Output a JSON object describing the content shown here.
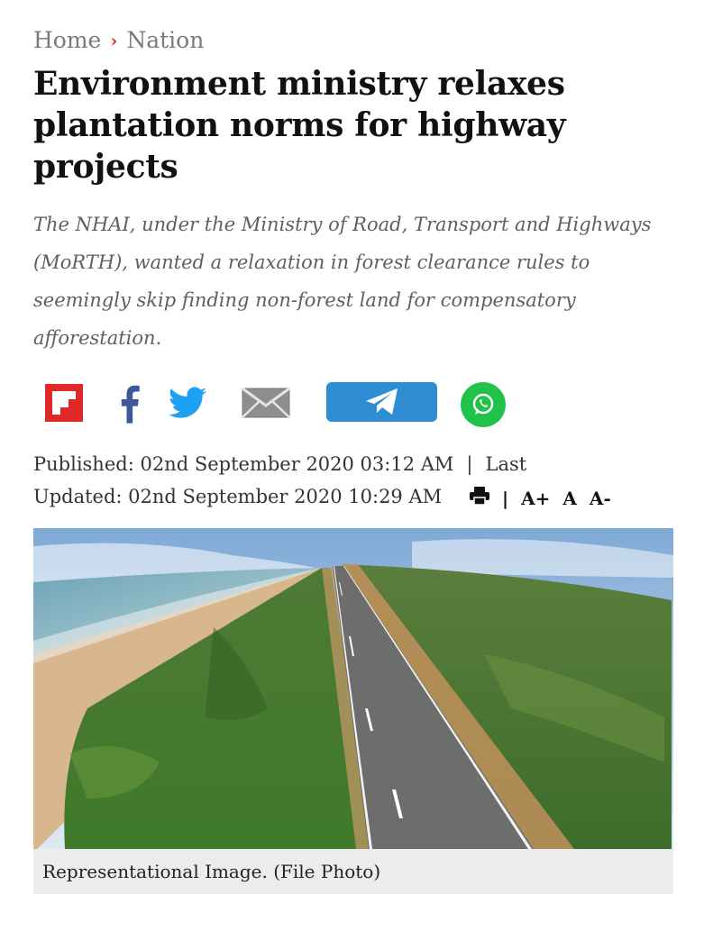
{
  "breadcrumb": {
    "home": "Home",
    "separator": "›",
    "section": "Nation"
  },
  "article": {
    "title": "Environment ministry relaxes plantation norms for highway projects",
    "summary": "The NHAI, under the Ministry of Road, Transport and Highways (MoRTH), wanted a relaxation in forest clearance rules to seemingly skip finding non-forest land for compensatory afforestation."
  },
  "share": {
    "icons": [
      "flipboard-icon",
      "facebook-icon",
      "twitter-icon",
      "email-icon",
      "telegram-icon",
      "whatsapp-icon"
    ],
    "colors": {
      "flipboard": "#e12828",
      "facebook": "#3b5998",
      "twitter": "#1da1f2",
      "email": "#9e9e9e",
      "telegram": "#2f8ed3",
      "whatsapp": "#22c24a"
    }
  },
  "meta": {
    "published": "Published: 02nd September 2020 03:12 AM",
    "separator": "|",
    "updated_prefix": "Last",
    "updated": "Updated: 02nd September 2020 10:29 AM",
    "tool_separator": "|",
    "font_increase": "A+",
    "font_normal": "A",
    "font_decrease": "A-"
  },
  "image": {
    "caption": "Representational Image. (File Photo)"
  }
}
